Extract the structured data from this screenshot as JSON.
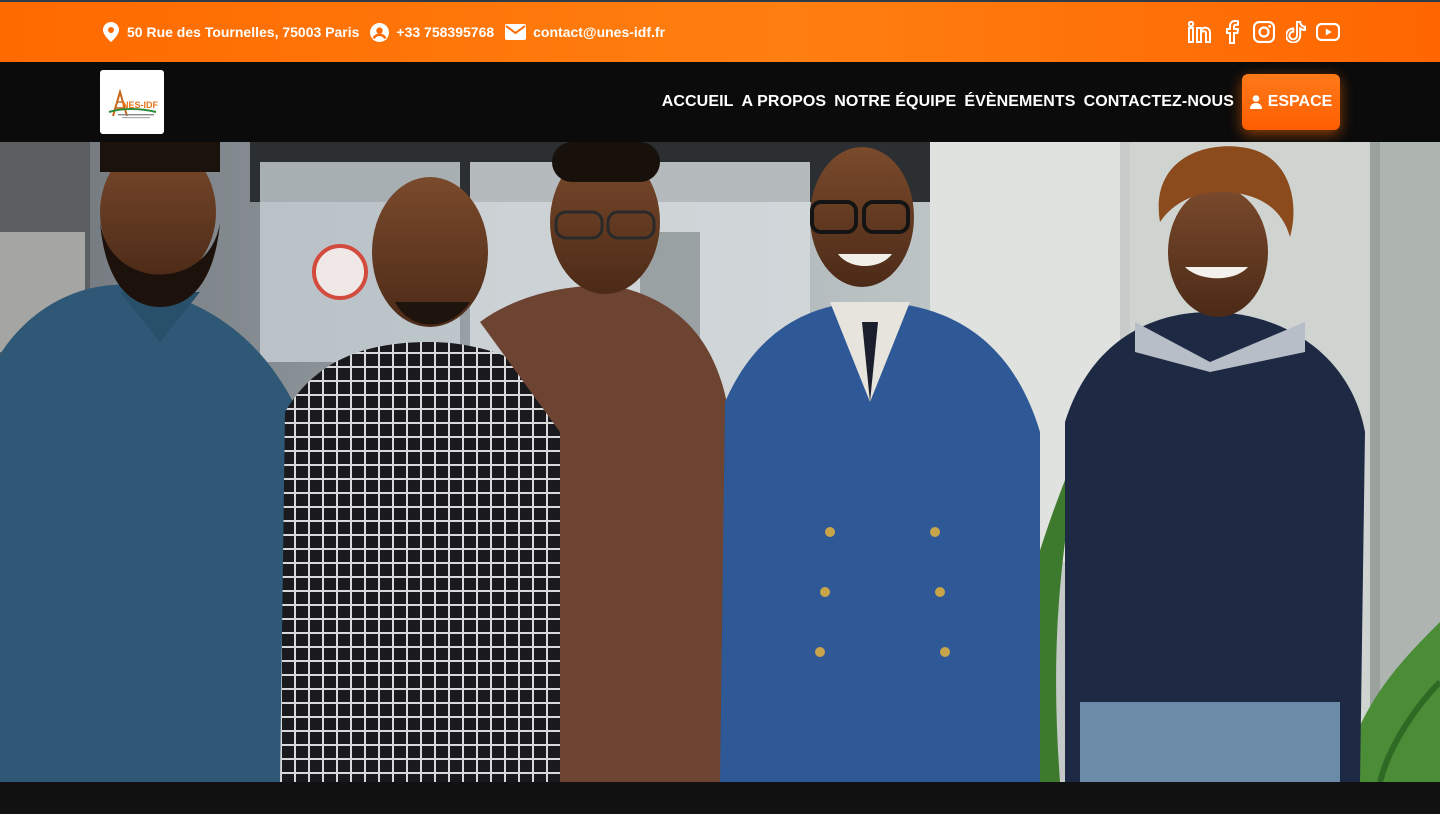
{
  "topbar": {
    "address": "50 Rue des Tournelles, 75003 Paris",
    "phone": "+33 758395768",
    "email": "contact@unes-idf.fr",
    "icons": {
      "address": "map-pin-icon",
      "phone": "user-circle-icon",
      "email": "envelope-icon"
    },
    "socials": [
      "linkedin-icon",
      "facebook-icon",
      "instagram-icon",
      "tiktok-icon",
      "youtube-icon"
    ],
    "background": "#ff6a00"
  },
  "nav": {
    "logo_text": "UNES-IDF",
    "items": [
      "ACCUEIL",
      "A PROPOS",
      "NOTRE ÉQUIPE",
      "ÉVÈNEMENTS",
      "CONTACTEZ-NOUS"
    ],
    "espace_label": "ESPACE",
    "espace_icon": "user-icon",
    "background": "#0b0b0b",
    "accent": "#ff6a00"
  },
  "hero": {
    "image": "team-photo"
  }
}
